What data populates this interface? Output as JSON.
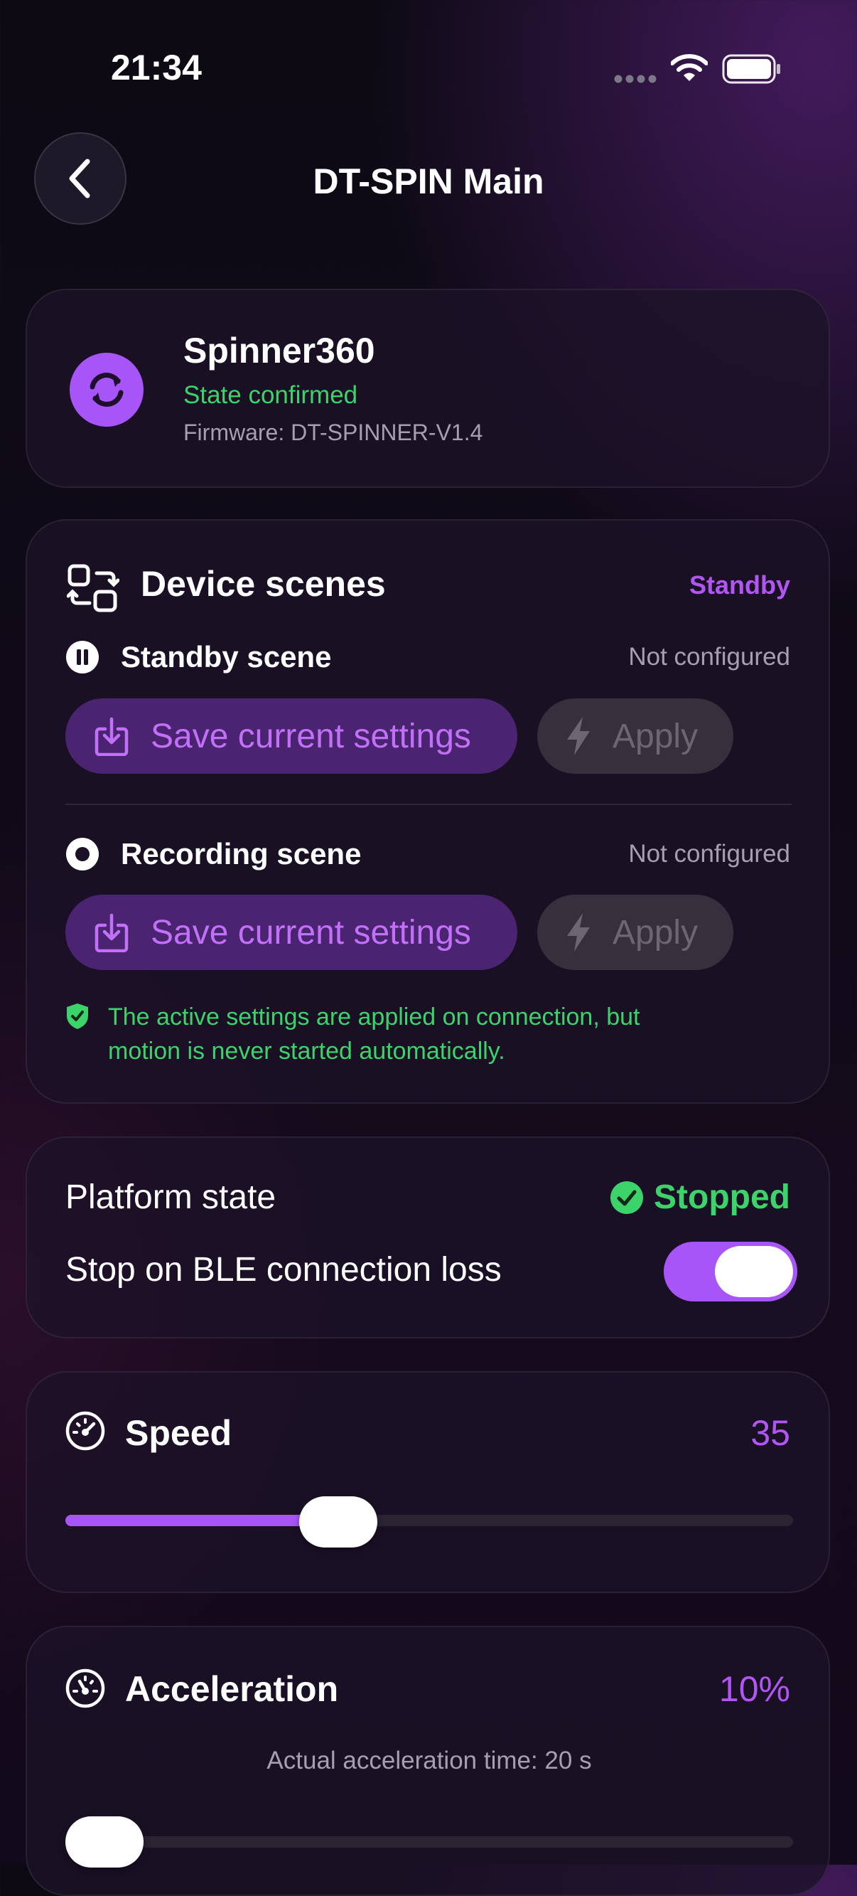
{
  "status_bar": {
    "time": "21:34"
  },
  "header": {
    "title": "DT-SPIN Main"
  },
  "device": {
    "name": "Spinner360",
    "state": "State confirmed",
    "firmware": "Firmware: DT-SPINNER-V1.4",
    "colors": {
      "accent": "#a855f7",
      "confirmed": "#3bd36a"
    }
  },
  "scenes": {
    "title": "Device scenes",
    "active": "Standby",
    "standby": {
      "label": "Standby scene",
      "status": "Not configured",
      "save_label": "Save current settings",
      "apply_label": "Apply"
    },
    "recording": {
      "label": "Recording scene",
      "status": "Not configured",
      "save_label": "Save current settings",
      "apply_label": "Apply"
    },
    "note_line1": "The active settings are applied on connection, but",
    "note_line2": "motion is never started automatically."
  },
  "platform": {
    "state_label": "Platform state",
    "state_value": "Stopped",
    "stop_label": "Stop on BLE connection loss",
    "stop_enabled": true
  },
  "speed": {
    "label": "Speed",
    "value": "35",
    "fraction": 0.36
  },
  "acceleration": {
    "label": "Acceleration",
    "value": "10%",
    "actual_time": "Actual acceleration time: 20 s",
    "fraction": 0.0
  }
}
